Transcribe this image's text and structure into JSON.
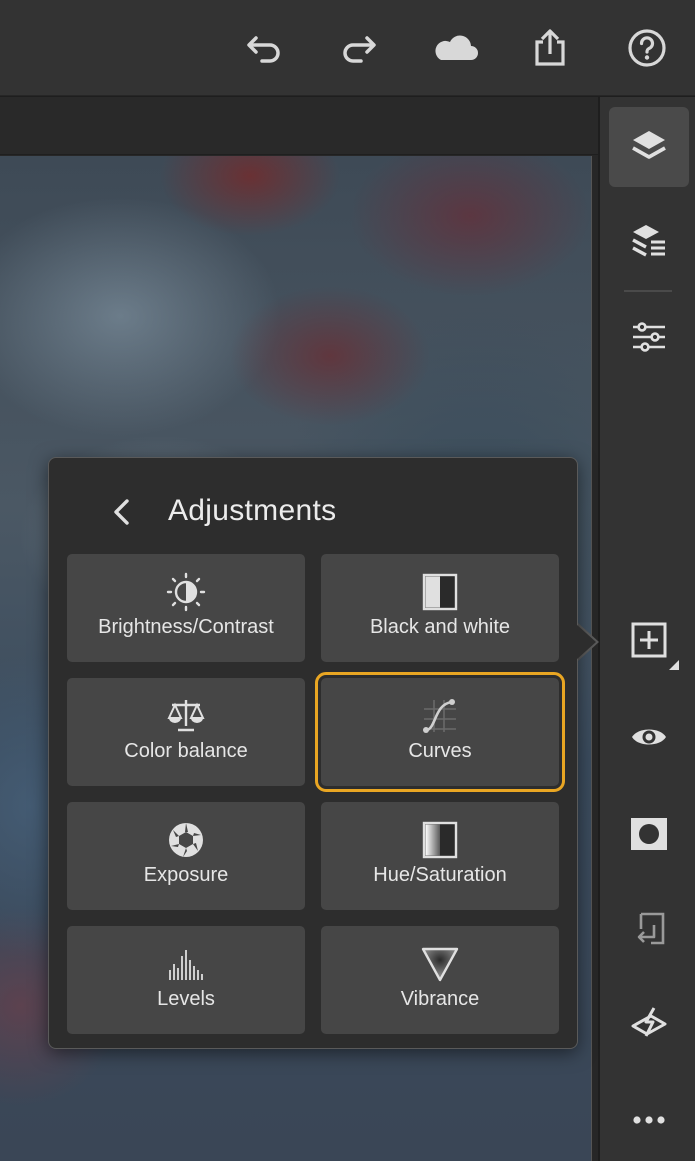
{
  "toolbar": {
    "undo_icon": "undo-icon",
    "redo_icon": "redo-icon",
    "cloud_icon": "cloud-icon",
    "share_icon": "share-icon",
    "help_icon": "help-icon"
  },
  "right_toolbar": {
    "items": [
      "layers-icon",
      "layer-properties-icon",
      "adjustments-sliders-icon",
      "add-adjustment-icon",
      "visibility-eye-icon",
      "mask-icon",
      "import-layer-icon",
      "heal-icon",
      "more-icon"
    ]
  },
  "adjustments_panel": {
    "title": "Adjustments",
    "selected": "Curves",
    "accent_color": "#e9a623",
    "items": [
      {
        "label": "Brightness/Contrast",
        "icon": "brightness-icon"
      },
      {
        "label": "Black and white",
        "icon": "black-white-icon"
      },
      {
        "label": "Color balance",
        "icon": "scales-icon"
      },
      {
        "label": "Curves",
        "icon": "curves-icon"
      },
      {
        "label": "Exposure",
        "icon": "aperture-icon"
      },
      {
        "label": "Hue/Saturation",
        "icon": "hue-saturation-icon"
      },
      {
        "label": "Levels",
        "icon": "levels-histogram-icon"
      },
      {
        "label": "Vibrance",
        "icon": "vibrance-triangle-icon"
      }
    ]
  }
}
